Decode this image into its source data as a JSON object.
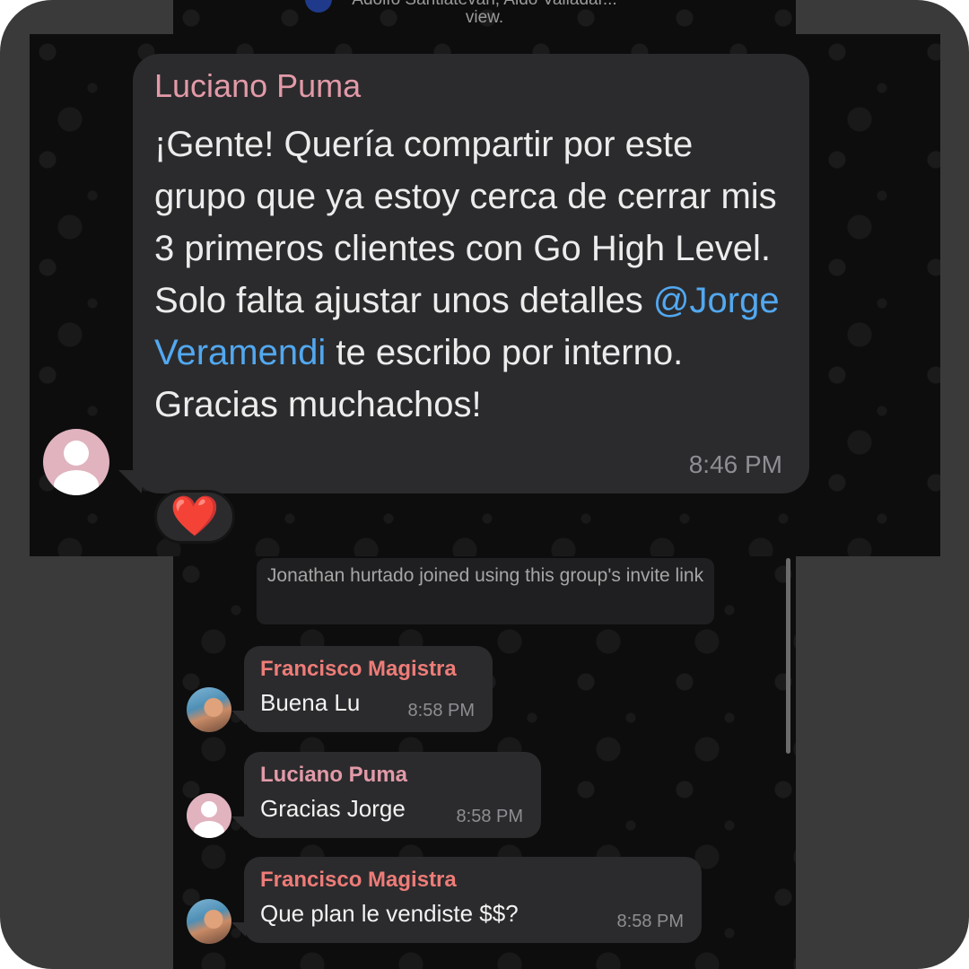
{
  "header": {
    "snippet_line1": "Adolfo Santiatevan, Aldo Valladar...",
    "snippet_line2": "view."
  },
  "zoomed_message": {
    "sender": "Luciano Puma",
    "text_before_mention": "¡Gente! Quería compartir por este grupo que ya estoy cerca de cerrar mis 3 primeros clientes con Go High Level. Solo falta ajustar unos detalles ",
    "mention": "@Jorge Veramendi",
    "text_after_mention": " te escribo por interno. Gracias muchachos!",
    "time": "8:46 PM",
    "reaction": "❤️"
  },
  "system_message": {
    "text": "Jonathan hurtado joined using this group's invite link"
  },
  "messages": [
    {
      "sender": "Francisco Magistra",
      "text": "Buena Lu",
      "time": "8:58 PM"
    },
    {
      "sender": "Luciano Puma",
      "text": "Gracias Jorge",
      "time": "8:58 PM"
    },
    {
      "sender": "Francisco Magistra",
      "text": "Que plan le vendiste $$?",
      "time": "8:58 PM"
    }
  ],
  "colors": {
    "frame": "#3a3a3a",
    "chat_background": "#0d0d0d",
    "bubble": "#2b2b2d",
    "mention": "#52a8f0",
    "sender_francisco": "#ee7c78",
    "sender_luciano": "#e29aa8"
  }
}
